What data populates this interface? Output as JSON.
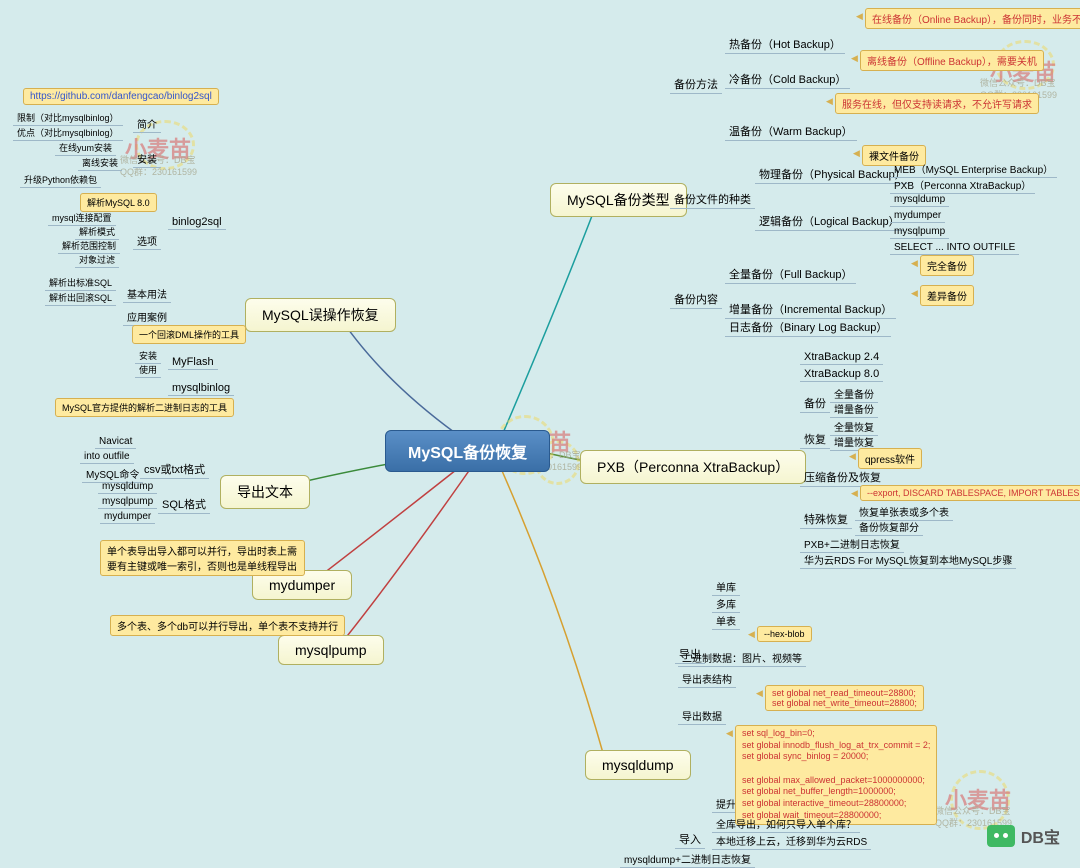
{
  "root": "MySQL备份恢复",
  "watermark": {
    "main": "小麦苗",
    "sub1": "微信公众号：DB宝",
    "sub2": "QQ群：230161599"
  },
  "logo": "DB宝",
  "branches": {
    "types": {
      "title": "MySQL备份类型",
      "method": {
        "label": "备份方法",
        "hot": "热备份（Hot Backup）",
        "hot_note": "在线备份（Online Backup），备份同时，业务不受影响",
        "cold": "冷备份（Cold Backup）",
        "cold_note": "离线备份（Offline Backup），需要关机",
        "warm": "温备份（Warm Backup）",
        "warm_note": "服务在线，但仅支持读请求，不允许写请求"
      },
      "file": {
        "label": "备份文件的种类",
        "physical": "物理备份（Physical Backup）",
        "physical_note": "裸文件备份",
        "meb": "MEB（MySQL Enterprise Backup）",
        "pxb": "PXB（Perconna XtraBackup）",
        "logical": "逻辑备份（Logical Backup）",
        "l1": "mysqldump",
        "l2": "mydumper",
        "l3": "mysqlpump",
        "l4": "SELECT ... INTO OUTFILE"
      },
      "content": {
        "label": "备份内容",
        "full": "全量备份（Full Backup）",
        "full_note": "完全备份",
        "inc": "增量备份（Incremental Backup）",
        "inc_note": "差异备份",
        "log": "日志备份（Binary Log Backup）"
      }
    },
    "pxb": {
      "title": "PXB（Perconna XtraBackup）",
      "v24": "XtraBackup 2.4",
      "v80": "XtraBackup 8.0",
      "backup": {
        "label": "备份",
        "full": "全量备份",
        "inc": "增量备份"
      },
      "restore": {
        "label": "恢复",
        "full": "全量恢复",
        "inc": "增量恢复",
        "qpress": "qpress软件"
      },
      "compress": "压缩备份及恢复",
      "compress_note": "--export, DISCARD TABLESPACE, IMPORT TABLESPACE",
      "special": {
        "label": "特殊恢复",
        "s1": "恢复单张表或多个表",
        "s2": "备份恢复部分"
      },
      "binlog": "PXB+二进制日志恢复",
      "huawei": "华为云RDS For MySQL恢复到本地MySQL步骤"
    },
    "mysqldump": {
      "title": "mysqldump",
      "export": {
        "label": "导出",
        "single_db": "单库",
        "multi_db": "多库",
        "single_table": "单表",
        "hex": "--hex-blob",
        "binary": "二进制数据：图片、视频等",
        "structure": "导出表结构",
        "data": "导出数据",
        "data_note": "set global net_read_timeout=28800;\nset global net_write_timeout=28800;"
      },
      "import": {
        "label": "导入",
        "speed": "提升速度",
        "speed_note": "set sql_log_bin=0;\nset global innodb_flush_log_at_trx_commit = 2;\nset global sync_binlog = 20000;\n\nset global max_allowed_packet=1000000000;\nset global net_buffer_length=1000000;\nset global interactive_timeout=28800000;\nset global wait_timeout=28800000;",
        "full_export": "全库导出，如何只导入单个库？",
        "migrate": "本地迁移上云，迁移到华为云RDS"
      },
      "binlog": "mysqldump+二进制日志恢复"
    },
    "mysqlpump": {
      "title": "mysqlpump",
      "note": "多个表、多个db可以并行导出，单个表不支持并行"
    },
    "mydumper": {
      "title": "mydumper",
      "note": "单个表导出导入都可以并行，导出时表上需要有主键或唯一索引，否则也是单线程导出"
    },
    "export_text": {
      "title": "导出文本",
      "csv": {
        "label": "csv或txt格式",
        "n1": "Navicat",
        "n2": "into outfile",
        "n3": "MySQL命令"
      },
      "sql": {
        "label": "SQL格式",
        "s1": "mysqldump",
        "s2": "mysqlpump",
        "s3": "mydumper"
      }
    },
    "recovery": {
      "title": "MySQL误操作恢复",
      "binlog2sql": {
        "label": "binlog2sql",
        "url": "https://github.com/danfengcao/binlog2sql",
        "intro": "简介",
        "intro_n1": "限制（对比mysqlbinlog）",
        "intro_n2": "优点（对比mysqlbinlog）",
        "install": "安装",
        "install_n1": "在线yum安装",
        "install_n2": "离线安装",
        "install_n3": "升级Python依赖包",
        "parse": "解析MySQL 8.0",
        "options": "选项",
        "opt_n1": "mysql连接配置",
        "opt_n2": "解析模式",
        "opt_n3": "解析范围控制",
        "opt_n4": "对象过滤",
        "basic": "基本用法",
        "basic_n1": "解析出标准SQL",
        "basic_n2": "解析出回滚SQL",
        "case": "应用案例"
      },
      "myflash": {
        "label": "MyFlash",
        "note": "一个回滚DML操作的工具",
        "n1": "安装",
        "n2": "使用"
      },
      "mysqlbinlog": {
        "label": "mysqlbinlog",
        "note": "MySQL官方提供的解析二进制日志的工具"
      }
    }
  }
}
